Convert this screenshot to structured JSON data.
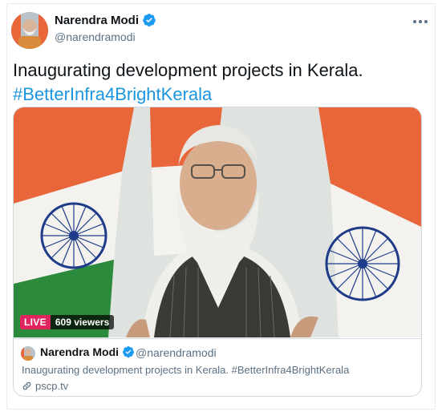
{
  "tweet": {
    "author_name": "Narendra Modi",
    "author_handle": "@narendramodi",
    "verified_icon": "verified-badge-icon",
    "more_icon": "more-dots-icon",
    "text_line1": "Inaugurating development projects in Kerala.",
    "hashtag": "#BetterInfra4BrightKerala"
  },
  "media": {
    "live_label": "LIVE",
    "viewers_label": "609 viewers",
    "colors": {
      "saffron": "#e8663a",
      "white": "#f4f2ee",
      "green": "#2c8a3c",
      "chakra": "#1f3c8a",
      "live_red": "#e0245e"
    }
  },
  "card": {
    "author_name": "Narendra Modi",
    "author_handle": "@narendramodi",
    "text": "Inaugurating development projects in Kerala. #BetterInfra4BrightKerala",
    "link_icon": "link-icon",
    "link": "pscp.tv"
  },
  "colors": {
    "accent": "#1b95e0",
    "verified": "#1d9bf0",
    "muted": "#5b7083"
  }
}
